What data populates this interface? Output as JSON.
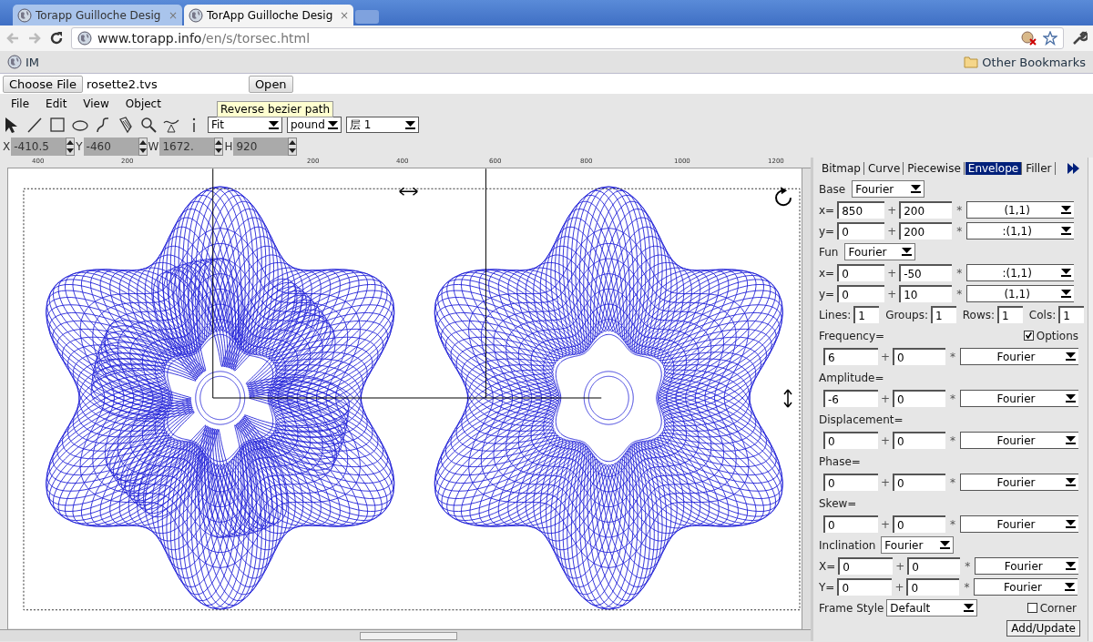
{
  "browser": {
    "tabs": [
      {
        "title": "Torapp Guilloche Desig",
        "close": "×",
        "selected": false
      },
      {
        "title": "TorApp Guilloche Desig",
        "close": "×",
        "selected": true
      }
    ],
    "address": {
      "host": "www.torapp.info",
      "path": "/en/s/torsec.html"
    },
    "bookmarks": [
      {
        "label": "IM",
        "kind": "site"
      },
      {
        "label": "Other Bookmarks",
        "kind": "folder"
      }
    ]
  },
  "file_picker": {
    "button": "Choose File",
    "file": "rosette2.tvs",
    "open": "Open"
  },
  "menu": [
    "File",
    "Edit",
    "View",
    "Object"
  ],
  "toolbar": {
    "selects": [
      "Fit",
      "pound",
      "层 1"
    ],
    "tooltip": "Reverse bezier path"
  },
  "geometry": [
    {
      "label": "X",
      "value": "-410.5"
    },
    {
      "label": "Y",
      "value": "-460"
    },
    {
      "label": "W",
      "value": "1672."
    },
    {
      "label": "H",
      "value": "920"
    }
  ],
  "ruler": [
    "400",
    "200",
    "200",
    "400",
    "600",
    "800",
    "1000",
    "1200"
  ],
  "panel": {
    "tabs": [
      {
        "label": "Bitmap",
        "selected": false
      },
      {
        "label": "Curve",
        "selected": false
      },
      {
        "label": "Piecewise",
        "selected": false
      },
      {
        "label": "Envelope",
        "selected": true
      },
      {
        "label": "Filler",
        "selected": false
      }
    ],
    "base": {
      "label": "Base",
      "value": "Fourier",
      "rows": [
        {
          "label": "x=",
          "a": "850",
          "plus": "+",
          "b": "200",
          "times": "*",
          "fn": "(1,1)"
        },
        {
          "label": "y=",
          "a": "0",
          "plus": "+",
          "b": "200",
          "times": "*",
          "fn": ":(1,1)"
        }
      ]
    },
    "fun": {
      "label": "Fun",
      "value": "Fourier",
      "rows": [
        {
          "label": "x=",
          "a": "0",
          "plus": "+",
          "b": "-50",
          "times": "*",
          "fn": ":(1,1)"
        },
        {
          "label": "y=",
          "a": "0",
          "plus": "+",
          "b": "10",
          "times": "*",
          "fn": "(1,1)"
        }
      ]
    },
    "counts": [
      {
        "label": "Lines:",
        "value": "1"
      },
      {
        "label": "Groups:",
        "value": "1"
      },
      {
        "label": "Rows:",
        "value": "1"
      },
      {
        "label": "Cols:",
        "value": "1"
      }
    ],
    "params": [
      {
        "label": "Frequency=",
        "a": "6",
        "plus": "+",
        "b": "0",
        "times": "*",
        "fn": "Fourier"
      },
      {
        "label": "Amplitude=",
        "a": "-6",
        "plus": "+",
        "b": "0",
        "times": "*",
        "fn": "Fourier"
      },
      {
        "label": "Displacement=",
        "a": "0",
        "plus": "+",
        "b": "0",
        "times": "*",
        "fn": "Fourier"
      },
      {
        "label": "Phase=",
        "a": "0",
        "plus": "+",
        "b": "0",
        "times": "*",
        "fn": "Fourier"
      },
      {
        "label": "Skew=",
        "a": "0",
        "plus": "+",
        "b": "0",
        "times": "*",
        "fn": "Fourier"
      }
    ],
    "options": {
      "label": "Options",
      "checked": true
    },
    "inclination": {
      "label": "Inclination",
      "value": "Fourier",
      "rows": [
        {
          "label": "X=",
          "a": "0",
          "plus": "+",
          "b": "0",
          "times": "*",
          "fn": "Fourier"
        },
        {
          "label": "Y=",
          "a": "0",
          "plus": "+",
          "b": "0",
          "times": "*",
          "fn": "Fourier"
        }
      ]
    },
    "frame_style": {
      "label": "Frame Style",
      "value": "Default"
    },
    "corner": {
      "label": "Corner",
      "checked": false
    },
    "submit": "Add/Update"
  }
}
